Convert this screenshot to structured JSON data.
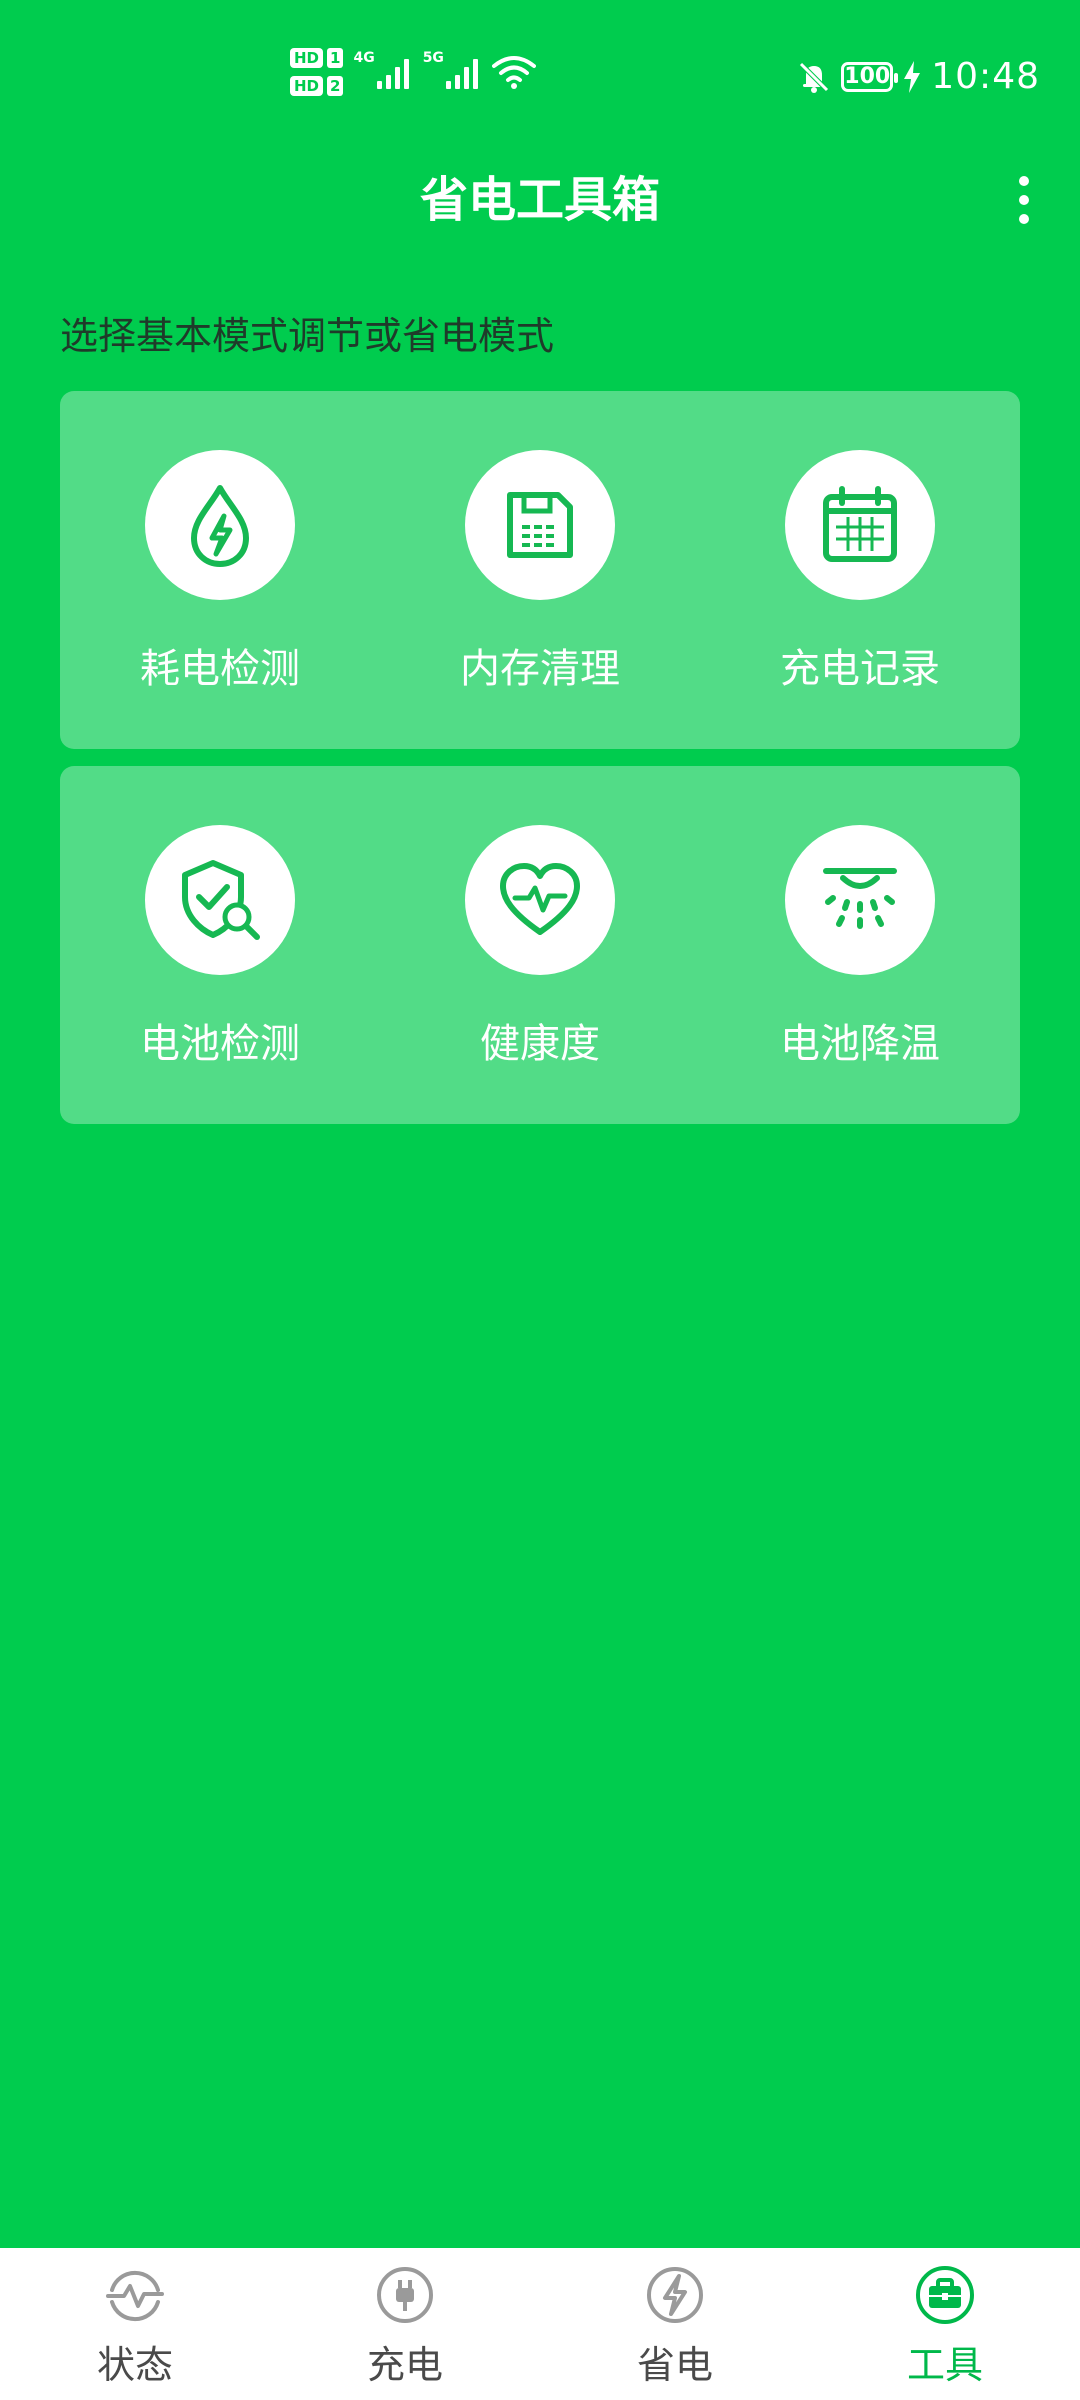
{
  "status_bar": {
    "hd1": "HD",
    "hd1_num": "1",
    "hd2": "HD",
    "hd2_num": "2",
    "net1": "4G",
    "net2": "5G",
    "battery": "100",
    "time": "10:48"
  },
  "header": {
    "title": "省电工具箱"
  },
  "subtitle": "选择基本模式调节或省电模式",
  "tools": {
    "row1": [
      {
        "label": "耗电检测",
        "icon": "power-drop-icon"
      },
      {
        "label": "内存清理",
        "icon": "floppy-disk-icon"
      },
      {
        "label": "充电记录",
        "icon": "calendar-icon"
      }
    ],
    "row2": [
      {
        "label": "电池检测",
        "icon": "shield-search-icon"
      },
      {
        "label": "健康度",
        "icon": "heart-pulse-icon"
      },
      {
        "label": "电池降温",
        "icon": "cooling-lamp-icon"
      }
    ]
  },
  "bottom_nav": {
    "items": [
      {
        "label": "状态",
        "icon": "pulse-icon"
      },
      {
        "label": "充电",
        "icon": "plug-icon"
      },
      {
        "label": "省电",
        "icon": "bolt-icon"
      },
      {
        "label": "工具",
        "icon": "toolbox-icon"
      }
    ],
    "active_index": 3
  },
  "colors": {
    "background": "#00CC4E",
    "card": "rgba(255,255,255,0.32)",
    "icon_green": "#16B852",
    "nav_active": "#00B84A",
    "nav_inactive": "#9a9a9a"
  }
}
